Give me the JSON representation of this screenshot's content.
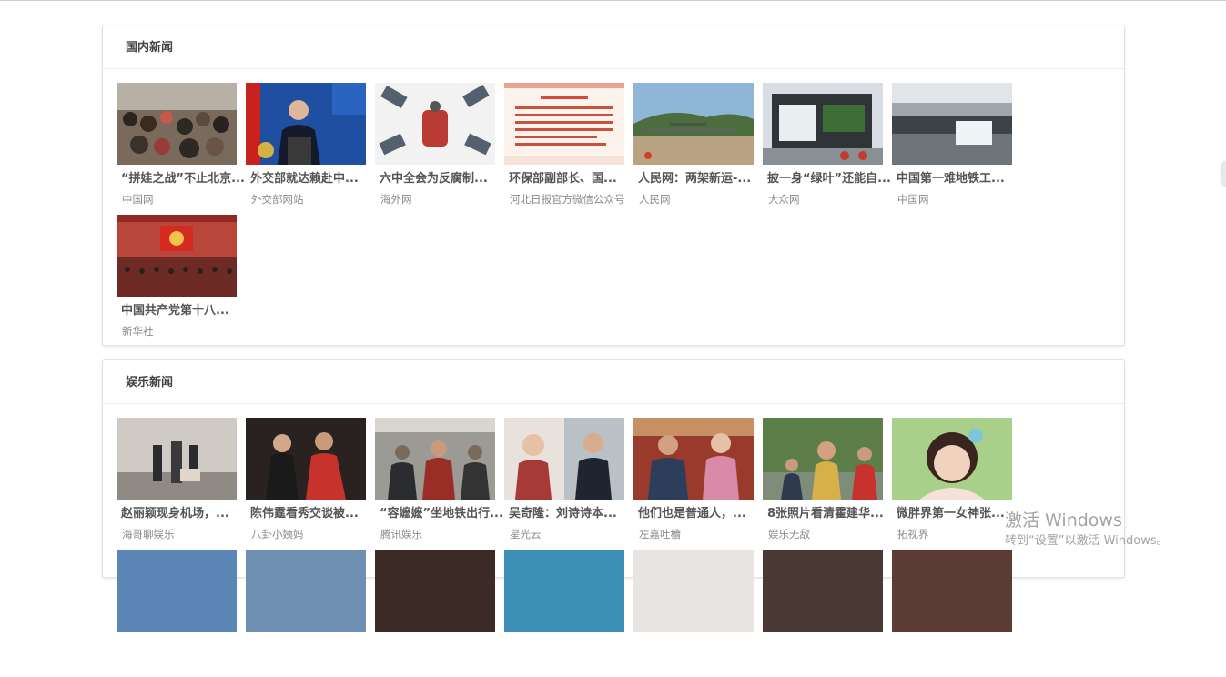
{
  "sections": {
    "domestic": {
      "title": "国内新闻",
      "items": [
        {
          "caption": "“拼娃之战”不止北京...",
          "source": "中国网"
        },
        {
          "caption": "外交部就达赖赴中...",
          "source": "外交部网站"
        },
        {
          "caption": "六中全会为反腐制...",
          "source": "海外网"
        },
        {
          "caption": "环保部副部长、国...",
          "source": "河北日报官方微信公众号"
        },
        {
          "caption": "人民网：两架新运-...",
          "source": "人民网"
        },
        {
          "caption": "披一身“绿叶”还能自...",
          "source": "大众网"
        },
        {
          "caption": "中国第一难地铁工...",
          "source": "中国网"
        },
        {
          "caption": "中国共产党第十八...",
          "source": "新华社"
        }
      ]
    },
    "entertainment": {
      "title": "娱乐新闻",
      "items": [
        {
          "caption": "赵丽颖现身机场，...",
          "source": "海哥聊娱乐"
        },
        {
          "caption": "陈伟霆看秀交谈被...",
          "source": "八卦小姨妈"
        },
        {
          "caption": "“容嬷嬷”坐地铁出行...",
          "source": "腾讯娱乐"
        },
        {
          "caption": "吴奇隆：刘诗诗本...",
          "source": "星光云"
        },
        {
          "caption": "他们也是普通人，...",
          "source": "左嘉吐槽"
        },
        {
          "caption": "8张照片看清霍建华...",
          "source": "娱乐无敌"
        },
        {
          "caption": "微胖界第一女神张...",
          "source": "拓视界"
        }
      ]
    }
  },
  "watermark": {
    "line1": "激活 Windows",
    "line2": "转到“设置”以激活 Windows。"
  }
}
